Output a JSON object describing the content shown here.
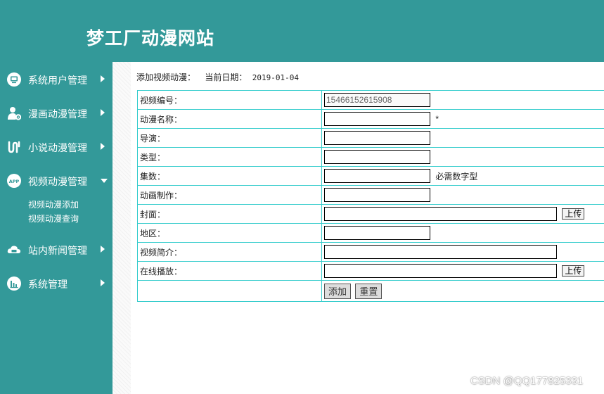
{
  "header": {
    "title": "梦工厂动漫网站"
  },
  "sidebar": {
    "items": [
      {
        "label": "系统用户管理",
        "icon": "monitor-icon",
        "expanded": false
      },
      {
        "label": "漫画动漫管理",
        "icon": "user-gear-icon",
        "expanded": false
      },
      {
        "label": "小说动漫管理",
        "icon": "link-icon",
        "expanded": false
      },
      {
        "label": "视频动漫管理",
        "icon": "app-icon",
        "expanded": true,
        "children": [
          "视频动漫添加",
          "视频动漫查询"
        ]
      },
      {
        "label": "站内新闻管理",
        "icon": "cloud-icon",
        "expanded": false
      },
      {
        "label": "系统管理",
        "icon": "bar-chart-icon",
        "expanded": false
      }
    ]
  },
  "breadcrumb": {
    "title": "添加视频动漫：",
    "date_label": "当前日期：",
    "date_value": "2019-01-04"
  },
  "form": {
    "rows": [
      {
        "label": "视频编号：",
        "value": "15466152615908",
        "note": ""
      },
      {
        "label": "动漫名称：",
        "value": "",
        "note": "*"
      },
      {
        "label": "导演：",
        "value": "",
        "note": ""
      },
      {
        "label": "类型：",
        "value": "",
        "note": ""
      },
      {
        "label": "集数：",
        "value": "",
        "note": "必需数字型"
      },
      {
        "label": "动画制作：",
        "value": "",
        "note": ""
      },
      {
        "label": "封面：",
        "value": "",
        "upload": "上传"
      },
      {
        "label": "地区：",
        "value": "",
        "note": ""
      },
      {
        "label": "视频简介：",
        "value": "",
        "note": ""
      },
      {
        "label": "在线播放：",
        "value": "",
        "upload": "上传"
      }
    ],
    "submit_label": "添加",
    "reset_label": "重置"
  },
  "watermark": "CSDN @QQ177825331",
  "colors": {
    "primary": "#339999",
    "table_border": "#33cccc"
  }
}
